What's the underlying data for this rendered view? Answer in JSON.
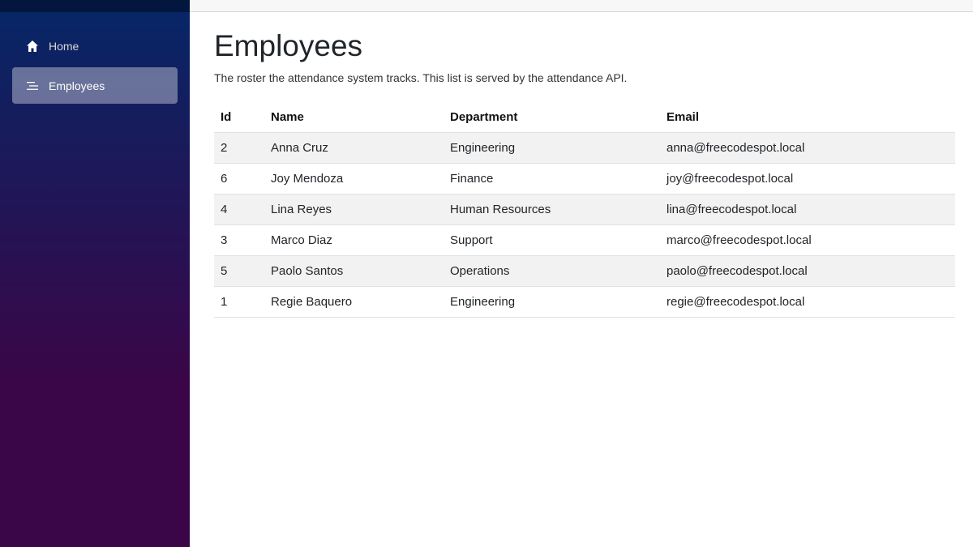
{
  "sidebar": {
    "items": [
      {
        "label": "Home",
        "icon": "home-icon",
        "active": false
      },
      {
        "label": "Employees",
        "icon": "list-icon",
        "active": true
      }
    ]
  },
  "main": {
    "title": "Employees",
    "subtitle": "The roster the attendance system tracks. This list is served by the attendance API.",
    "table": {
      "headers": [
        "Id",
        "Name",
        "Department",
        "Email"
      ],
      "rows": [
        [
          "2",
          "Anna Cruz",
          "Engineering",
          "anna@freecodespot.local"
        ],
        [
          "6",
          "Joy Mendoza",
          "Finance",
          "joy@freecodespot.local"
        ],
        [
          "4",
          "Lina Reyes",
          "Human Resources",
          "lina@freecodespot.local"
        ],
        [
          "3",
          "Marco Diaz",
          "Support",
          "marco@freecodespot.local"
        ],
        [
          "5",
          "Paolo Santos",
          "Operations",
          "paolo@freecodespot.local"
        ],
        [
          "1",
          "Regie Baquero",
          "Engineering",
          "regie@freecodespot.local"
        ]
      ]
    }
  },
  "colors": {
    "sidebar_top": "#052767",
    "sidebar_bottom": "#3a0647",
    "active_item": "rgba(255,255,255,0.37)",
    "row_stripe": "#f2f2f2"
  }
}
